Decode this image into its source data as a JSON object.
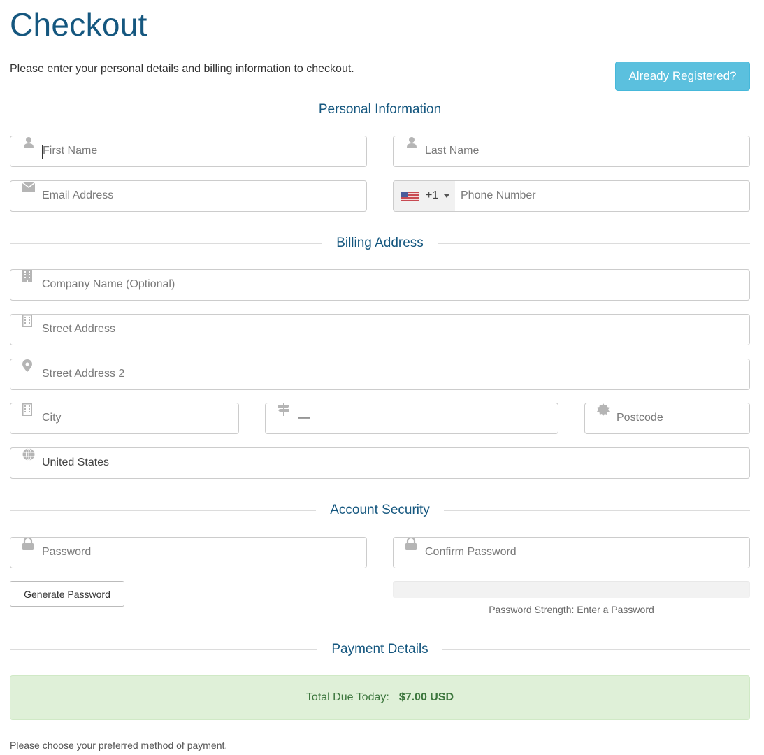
{
  "page": {
    "title": "Checkout",
    "intro": "Please enter your personal details and billing information to checkout.",
    "already_registered_label": "Already Registered?"
  },
  "colors": {
    "title_blue": "#15577f",
    "info_button": "#5bc0de",
    "success_bg": "#dff0d8",
    "success_text": "#3c763d"
  },
  "sections": {
    "personal": "Personal Information",
    "billing": "Billing Address",
    "security": "Account Security",
    "payment": "Payment Details"
  },
  "personal": {
    "first_name": {
      "placeholder": "First Name",
      "icon": "user-icon"
    },
    "last_name": {
      "placeholder": "Last Name",
      "icon": "user-icon"
    },
    "email": {
      "placeholder": "Email Address",
      "icon": "envelope-icon"
    },
    "phone": {
      "placeholder": "Phone Number",
      "country_flag": "us-flag-icon",
      "dial_code": "+1"
    }
  },
  "billing": {
    "company": {
      "placeholder": "Company Name (Optional)",
      "icon": "building-icon"
    },
    "street": {
      "placeholder": "Street Address",
      "icon": "building-outline-icon"
    },
    "street2": {
      "placeholder": "Street Address 2",
      "icon": "map-marker-icon"
    },
    "city": {
      "placeholder": "City",
      "icon": "building-outline-icon"
    },
    "state": {
      "value": "—",
      "icon": "signpost-icon"
    },
    "postcode": {
      "placeholder": "Postcode",
      "icon": "certificate-icon"
    },
    "country": {
      "value": "United States",
      "icon": "globe-icon"
    }
  },
  "security": {
    "password": {
      "placeholder": "Password",
      "icon": "lock-icon"
    },
    "confirm_password": {
      "placeholder": "Confirm Password",
      "icon": "lock-icon"
    },
    "generate_label": "Generate Password",
    "strength_text": "Password Strength: Enter a Password",
    "strength_percent": 0
  },
  "payment": {
    "total_label": "Total Due Today:",
    "total_amount": "$7.00 USD",
    "method_prompt": "Please choose your preferred method of payment."
  }
}
